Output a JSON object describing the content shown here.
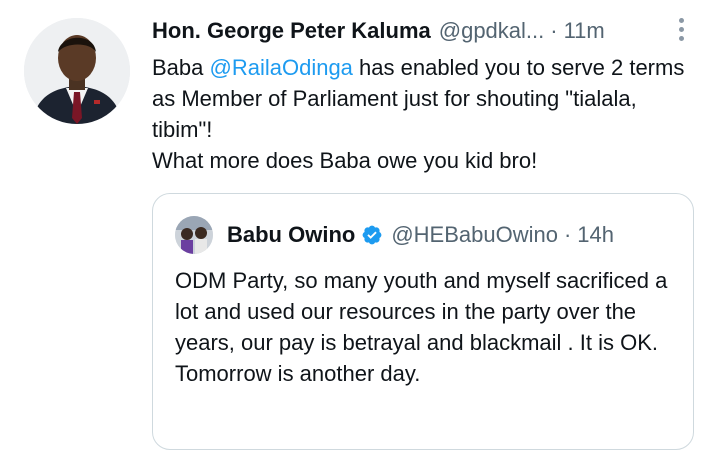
{
  "tweet": {
    "author_name": "Hon. George Peter Kaluma",
    "handle": "@gpdkal...",
    "separator": "·",
    "time": "11m",
    "body": {
      "text_before": "Baba ",
      "mention": "@RailaOdinga",
      "text_line1_rest": " has enabled you to serve 2 terms as Member of Parliament just for shouting \"tialala, tibim\"!",
      "text_line2": "What more does Baba owe you kid bro!"
    },
    "more_icon": "more-vertical-icon"
  },
  "quoted_tweet": {
    "author_name": "Babu Owino",
    "verified_icon": "verified-badge-icon",
    "handle": "@HEBabuOwino",
    "separator": "·",
    "time": "14h",
    "body": "ODM Party, so many youth and myself sacrificed a lot and used our resources in the party over the years, our pay is betrayal and blackmail . It is OK. Tomorrow is another day."
  },
  "colors": {
    "text": "#0f1419",
    "secondary": "#536471",
    "link": "#1d9bf0",
    "border": "#cfd9de"
  }
}
